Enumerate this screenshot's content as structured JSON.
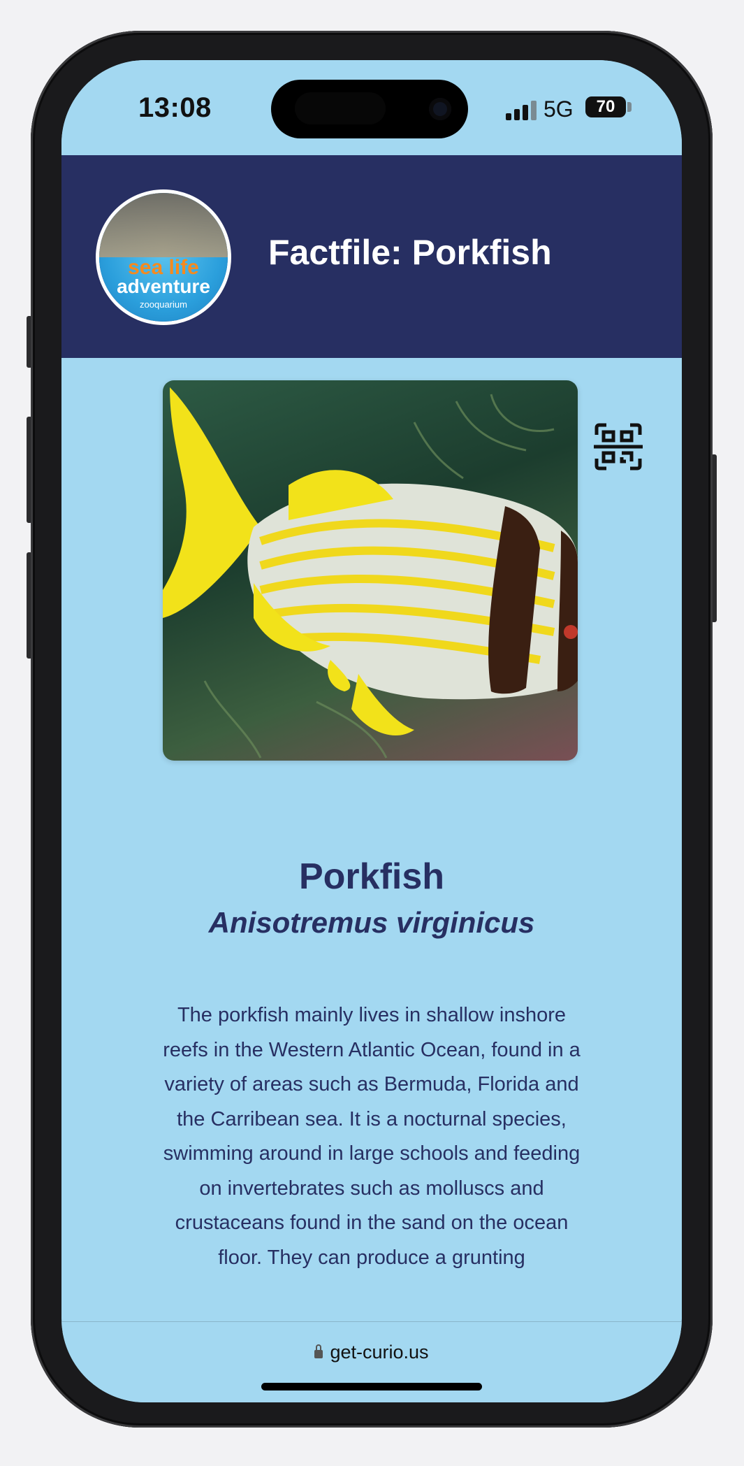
{
  "status_bar": {
    "time": "13:08",
    "network": "5G",
    "battery": "70"
  },
  "header": {
    "logo": {
      "line1": "sea life",
      "line2": "adventure",
      "line3": "zooquarium"
    },
    "title": "Factfile: Porkfish"
  },
  "species": {
    "common_name": "Porkfish",
    "scientific_name": "Anisotremus virginicus",
    "description": "The porkfish mainly lives in shallow inshore reefs in the Western Atlantic Ocean, found in a variety of areas such as Bermuda, Florida and the Carribean sea. It is a nocturnal species, swimming around in large schools and feeding on invertebrates such as molluscs and crustaceans found in the sand on the ocean floor. They can produce a grunting"
  },
  "browser": {
    "url": "get-curio.us"
  },
  "colors": {
    "background": "#a3d8f1",
    "header": "#272f62",
    "text": "#272f62"
  },
  "icons": [
    "qr-code-icon",
    "lock-icon",
    "signal-icon",
    "battery-icon"
  ]
}
